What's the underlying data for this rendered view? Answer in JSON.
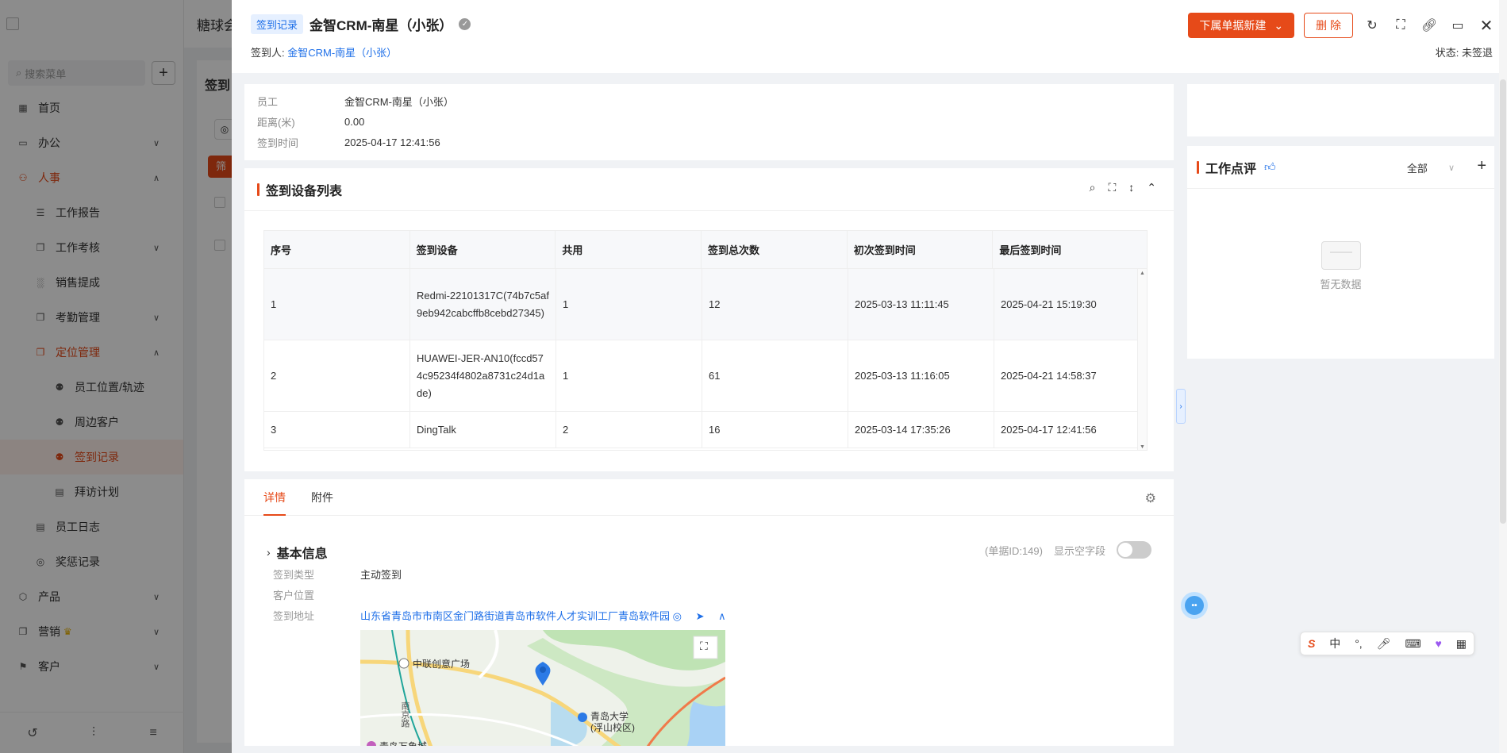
{
  "sidebar": {
    "search_placeholder": "搜索菜单",
    "items": [
      {
        "label": "首页",
        "icon": "grid-icon"
      },
      {
        "label": "办公",
        "icon": "monitor-icon"
      },
      {
        "label": "人事",
        "icon": "people-icon"
      },
      {
        "label": "工作报告",
        "icon": "report-icon"
      },
      {
        "label": "工作考核",
        "icon": "copy-icon"
      },
      {
        "label": "销售提成",
        "icon": "chart-icon"
      },
      {
        "label": "考勤管理",
        "icon": "copy-icon"
      },
      {
        "label": "定位管理",
        "icon": "copy-icon"
      },
      {
        "label": "员工位置/轨迹",
        "icon": "person-pin-icon"
      },
      {
        "label": "周边客户",
        "icon": "person-pin-icon"
      },
      {
        "label": "签到记录",
        "icon": "person-pin-icon"
      },
      {
        "label": "拜访计划",
        "icon": "plan-icon"
      },
      {
        "label": "员工日志",
        "icon": "log-icon"
      },
      {
        "label": "奖惩记录",
        "icon": "award-icon"
      },
      {
        "label": "产品",
        "icon": "cube-icon"
      },
      {
        "label": "营销",
        "icon": "copy-icon"
      },
      {
        "label": "客户",
        "icon": "flag-icon"
      }
    ]
  },
  "background": {
    "app_title": "糖球会",
    "page_title": "签到",
    "filter_label": "筛"
  },
  "drawer": {
    "tag": "签到记录",
    "title": "金智CRM-南星（小张）",
    "signer_label": "签到人:",
    "signer_value": "金智CRM-南星（小张）",
    "status_label": "状态:",
    "status_value": "未签退",
    "new_button": "下属单据新建",
    "delete_button": "删 除"
  },
  "info": {
    "rows": [
      {
        "label": "员工",
        "value": "金智CRM-南星（小张）"
      },
      {
        "label": "距离(米)",
        "value": "0.00"
      },
      {
        "label": "签到时间",
        "value": "2025-04-17 12:41:56"
      }
    ]
  },
  "devices": {
    "title": "签到设备列表",
    "columns": [
      "序号",
      "签到设备",
      "共用",
      "签到总次数",
      "初次签到时间",
      "最后签到时间"
    ],
    "rows": [
      [
        "1",
        "Redmi-22101317C(74b7c5af9eb942cabcffb8cebd27345)",
        "1",
        "12",
        "2025-03-13 11:11:45",
        "2025-04-21 15:19:30"
      ],
      [
        "2",
        "HUAWEI-JER-AN10(fccd574c95234f4802a8731c24d1ade)",
        "1",
        "61",
        "2025-03-13 11:16:05",
        "2025-04-21 14:58:37"
      ],
      [
        "3",
        "DingTalk",
        "2",
        "16",
        "2025-03-14 17:35:26",
        "2025-04-17 12:41:56"
      ]
    ]
  },
  "detail": {
    "tabs": [
      "详情",
      "附件"
    ],
    "section_title": "基本信息",
    "record_id": "(单据ID:149)",
    "show_empty_label": "显示空字段",
    "fields": [
      {
        "label": "签到类型",
        "value": "主动签到"
      },
      {
        "label": "客户位置",
        "value": ""
      },
      {
        "label": "签到地址",
        "value": "山东省青岛市市南区金门路街道青岛市软件人才实训工厂青岛软件园"
      }
    ],
    "map": {
      "label1": "中联创意广场",
      "label2": "青岛大学",
      "label3": "(浮山校区)",
      "road": "南京路",
      "bottom": "青岛万象城"
    }
  },
  "review": {
    "title": "工作点评",
    "filter": "全部",
    "empty": "暂无数据"
  },
  "ime": {
    "lang": "中"
  },
  "colors": {
    "accent": "#e64a19",
    "link": "#1e6fe8"
  }
}
